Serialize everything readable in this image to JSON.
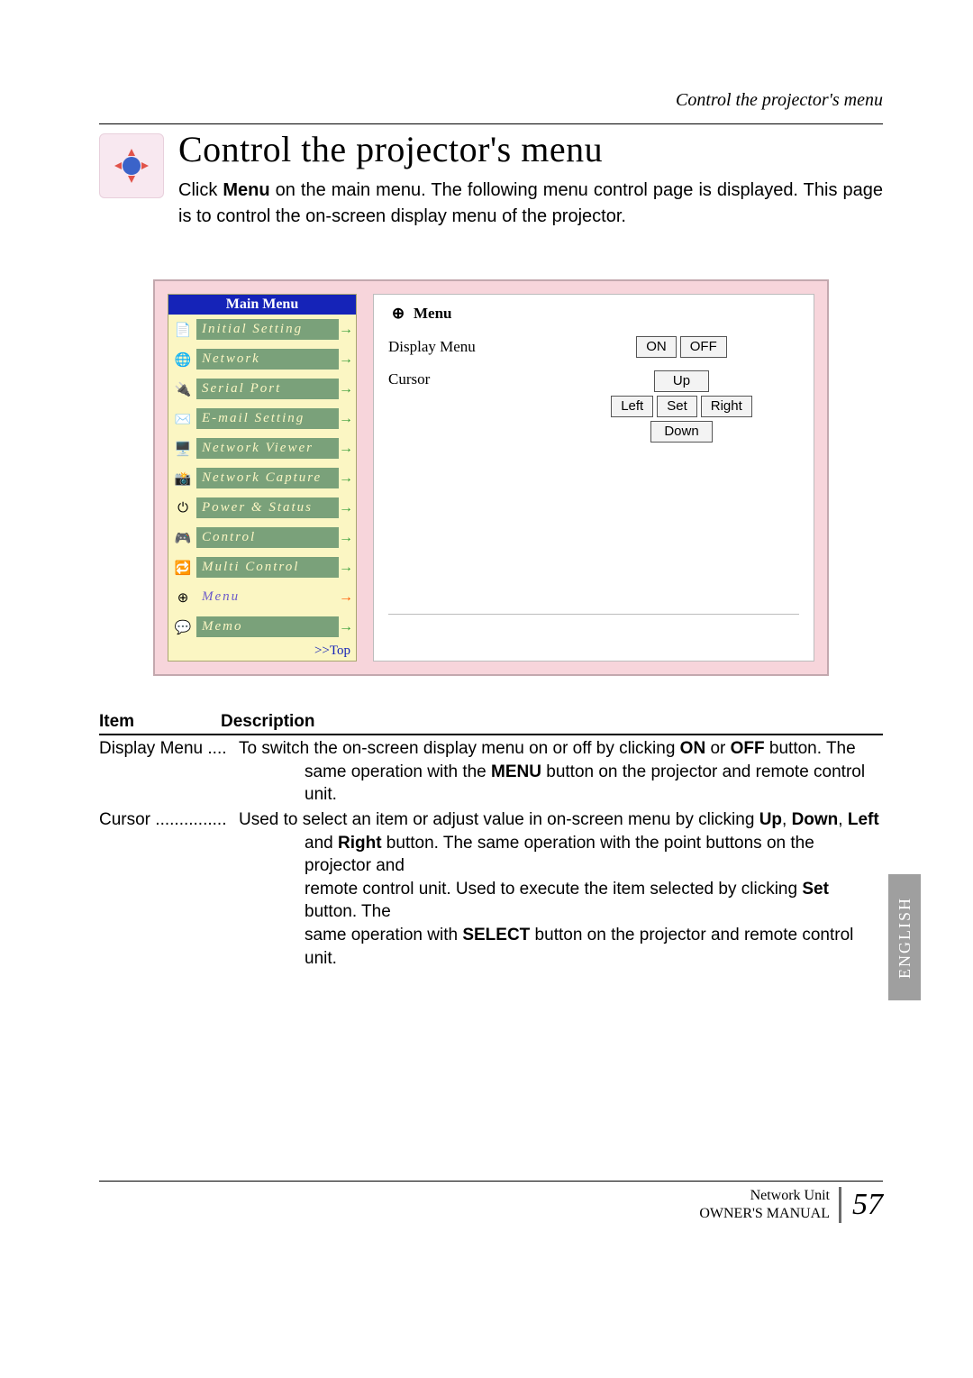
{
  "header_line": "Control the projector's menu",
  "title": "Control the projector's menu",
  "intro_pre": "Click ",
  "intro_bold": "Menu",
  "intro_post": " on the main menu. The following menu control page is displayed. This page is to control the on-screen display menu of the projector.",
  "sidebar": {
    "title": "Main Menu",
    "items": [
      "Initial Setting",
      "Network",
      "Serial Port",
      "E-mail Setting",
      "Network Viewer",
      "Network Capture",
      "Power & Status",
      "Control",
      "Multi Control",
      "Menu",
      "Memo"
    ],
    "top": ">>Top"
  },
  "panel": {
    "title": "Menu",
    "row1_label": "Display Menu",
    "on": "ON",
    "off": "OFF",
    "row2_label": "Cursor",
    "up": "Up",
    "left": "Left",
    "set": "Set",
    "right": "Right",
    "down": "Down"
  },
  "desc": {
    "h_item": "Item",
    "h_desc": "Description",
    "r1_item": "Display Menu",
    "r1_dots": " ....",
    "r1_text": "To switch the on-screen display menu on or off by clicking ",
    "r1_b1": "ON",
    "r1_mid": " or ",
    "r1_b2": "OFF",
    "r1_tail": " button. The",
    "r1_cont": "same operation with the ",
    "r1_b3": "MENU",
    "r1_cont2": " button on the projector and remote control unit.",
    "r2_item": "Cursor",
    "r2_dots": " ...............",
    "r2_text": "Used to select an item or adjust value in on-screen menu by clicking ",
    "r2_b1": "Up",
    "r2_c1": ", ",
    "r2_b2": "Down",
    "r2_c2": ", ",
    "r2_b3": "Left",
    "r2_cont1_a": "and ",
    "r2_b4": "Right",
    "r2_cont1_b": " button. The same operation with the point buttons on the projector and",
    "r2_cont2_a": "remote control unit. Used to execute the item selected by clicking ",
    "r2_b5": "Set",
    "r2_cont2_b": " button. The",
    "r2_cont3_a": "same operation with ",
    "r2_b6": "SELECT",
    "r2_cont3_b": " button on the projector and remote control unit."
  },
  "lang": "ENGLISH",
  "footer": {
    "line1": "Network Unit",
    "line2": "OWNER'S MANUAL",
    "page": "57"
  }
}
